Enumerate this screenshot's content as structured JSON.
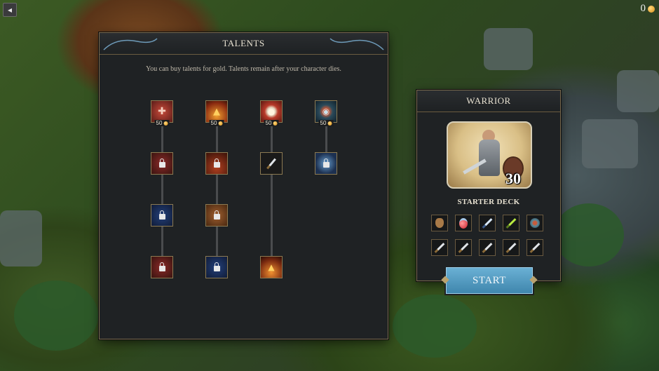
{
  "hud": {
    "back_icon": "arrow-left-icon",
    "gold": "0"
  },
  "talents": {
    "title": "TALENTS",
    "description": "You can buy talents for gold. Talents remain after your character dies.",
    "columns": [
      {
        "tier1": {
          "icon": "bleeding-heart-icon",
          "price": "50"
        },
        "nodes": [
          "locked-heart-talent",
          "locked-talent",
          "locked-heart-talent"
        ]
      },
      {
        "tier1": {
          "icon": "fire-icon",
          "price": "50"
        },
        "nodes": [
          "locked-fire-talent",
          "locked-talent",
          "locked-talent"
        ]
      },
      {
        "tier1": {
          "icon": "fist-icon",
          "price": "50"
        },
        "nodes": [
          "sword-talent",
          "fire-talent"
        ]
      },
      {
        "tier1": {
          "icon": "orb-icon",
          "price": "50"
        },
        "nodes": [
          "locked-frost-talent"
        ]
      }
    ]
  },
  "warrior": {
    "title": "WARRIOR",
    "level": "30",
    "deck_title": "STARTER DECK",
    "deck_row1": [
      "pouch-icon",
      "potion-icon",
      "dagger-icon",
      "poison-dagger-icon",
      "orb-icon"
    ],
    "deck_row2": [
      "sword-icon",
      "sword-icon",
      "sword-icon",
      "sword-icon",
      "sword-icon"
    ],
    "start_label": "START"
  },
  "colors": {
    "panel_bg": "#1f2224",
    "panel_border": "#7a6a4e",
    "start_button": "#4f9cc4"
  }
}
